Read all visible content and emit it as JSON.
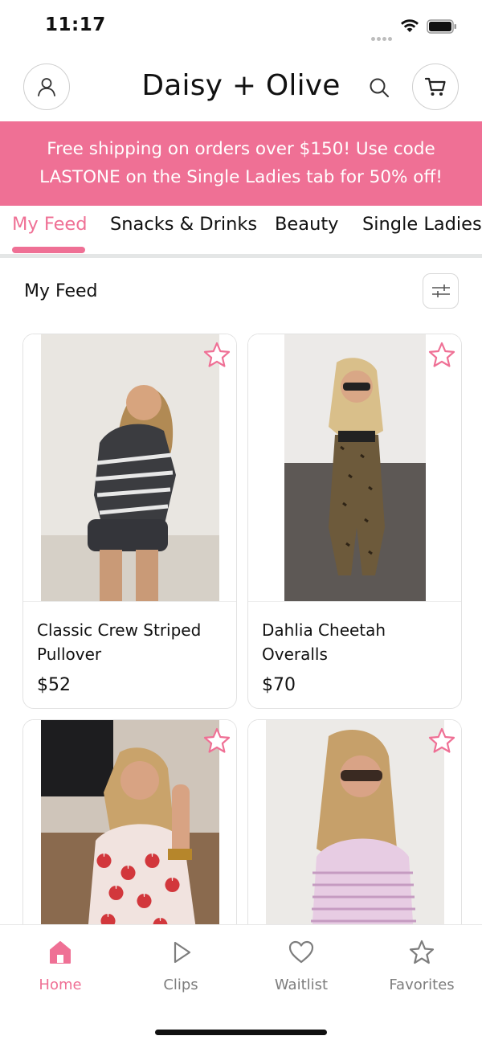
{
  "status_bar": {
    "time": "11:17"
  },
  "header": {
    "brand": "Daisy + Olive"
  },
  "promo": {
    "line1": "Free shipping on orders over $150! Use code",
    "line2": "LASTONE on the Single Ladies tab for 50% off!"
  },
  "tabs": [
    {
      "label": "My Feed",
      "active": true
    },
    {
      "label": "Snacks & Drinks",
      "active": false
    },
    {
      "label": "Beauty",
      "active": false
    },
    {
      "label": "Single Ladies",
      "active": false
    }
  ],
  "feed": {
    "title": "My Feed"
  },
  "products": [
    {
      "name": "Classic Crew Striped Pullover",
      "price": "$52"
    },
    {
      "name": "Dahlia Cheetah Overalls",
      "price": "$70"
    },
    {
      "name": "",
      "price": ""
    },
    {
      "name": "",
      "price": ""
    }
  ],
  "bottom_nav": [
    {
      "label": "Home",
      "icon": "home-icon",
      "active": true
    },
    {
      "label": "Clips",
      "icon": "play-icon",
      "active": false
    },
    {
      "label": "Waitlist",
      "icon": "heart-icon",
      "active": false
    },
    {
      "label": "Favorites",
      "icon": "star-icon",
      "active": false
    }
  ],
  "colors": {
    "accent": "#ef7095",
    "inactive": "#7d7d7d",
    "divider": "#e4e6e6"
  }
}
